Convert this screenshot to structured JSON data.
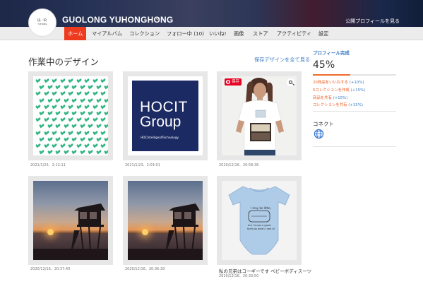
{
  "header": {
    "store_name": "GUOLONG YUHONGHONG",
    "caret": "⌄",
    "public_profile_link": "公開プロフィールを見る",
    "logo": {
      "line1": "以·公",
      "line2": "YUHONG"
    }
  },
  "nav": {
    "items": [
      {
        "label": "ホーム",
        "active": true
      },
      {
        "label": "マイアルバム"
      },
      {
        "label": "コレクション"
      },
      {
        "label": "フォロー中 (10)"
      },
      {
        "label": "いいね!"
      },
      {
        "label": "画像"
      },
      {
        "label": "ストア"
      },
      {
        "label": "アクティビティ"
      },
      {
        "label": "設定"
      }
    ]
  },
  "main": {
    "section_title": "作業中のデザイン",
    "see_all_link": "保存デザインを全て見る",
    "designs": [
      {
        "date": "2021/1/23、2:12:11",
        "caption": ""
      },
      {
        "date": "2021/1/23、2:03:01",
        "caption": "",
        "art": {
          "line1": "HOCIT",
          "line2": "Group",
          "line3": "HOCIntelligentTechnology"
        }
      },
      {
        "date": "2020/12/16、20:58:36",
        "caption": "",
        "save_label": "保存"
      },
      {
        "date": "2020/12/16、20:37:40",
        "caption": ""
      },
      {
        "date": "2020/12/16、20:36:39",
        "caption": ""
      },
      {
        "date": "2020/12/16、20:33:50",
        "caption": "私の兄弟はコーギーです ベビーボディスーツ"
      }
    ]
  },
  "sidebar": {
    "profile_title": "プロフィール完成",
    "profile_percent": "45%",
    "profile_progress": 0.45,
    "tasks": [
      {
        "label": "20商品をいいねする",
        "points": "(+10%)"
      },
      {
        "label": "5コレクションを作成",
        "points": "(+15%)"
      },
      {
        "label": "商品を共有",
        "points": "(+15%)"
      },
      {
        "label": "コレクションを共有",
        "points": "(+15%)"
      }
    ],
    "connect_title": "コネクト"
  },
  "colors": {
    "accent": "#ee3b1f",
    "link": "#3a7ac2",
    "progress": "#ef6b2a"
  }
}
